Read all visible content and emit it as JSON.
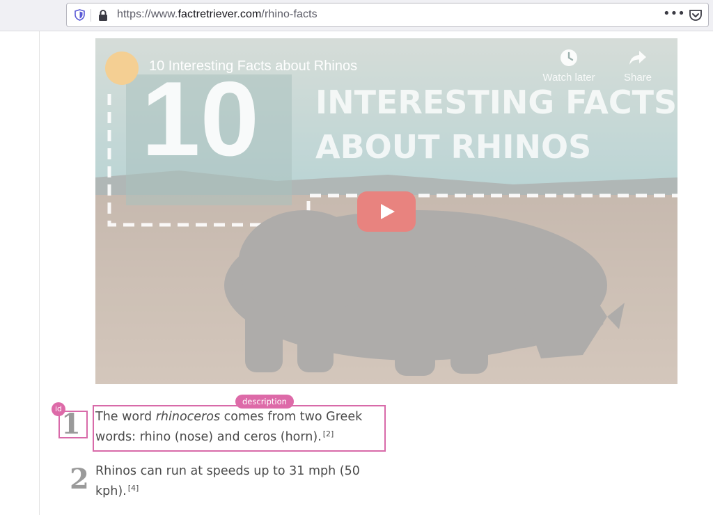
{
  "browser": {
    "url_prefix": "https://www.",
    "url_host": "factretriever.com",
    "url_path": "/rhino-facts",
    "more_label": "•••"
  },
  "video": {
    "title": "10 Interesting Facts about Rhinos",
    "big_number": "10",
    "headline_line1": "INTERESTING FACTS",
    "headline_line2": "ABOUT RHINOS",
    "watch_later_label": "Watch later",
    "share_label": "Share",
    "accent_color": "#ff0000"
  },
  "facts": [
    {
      "number": "1",
      "text_before": "The word ",
      "text_italic": "rhinoceros",
      "text_after": " comes from two Greek words: rhino (nose) and ceros (horn).",
      "citation": "[2]"
    },
    {
      "number": "2",
      "text": "Rhinos can run at speeds up to 31 mph (50 kph).",
      "citation": "[4]"
    }
  ],
  "annotations": {
    "id_label": "id",
    "description_label": "description",
    "color": "#d86aa9"
  }
}
